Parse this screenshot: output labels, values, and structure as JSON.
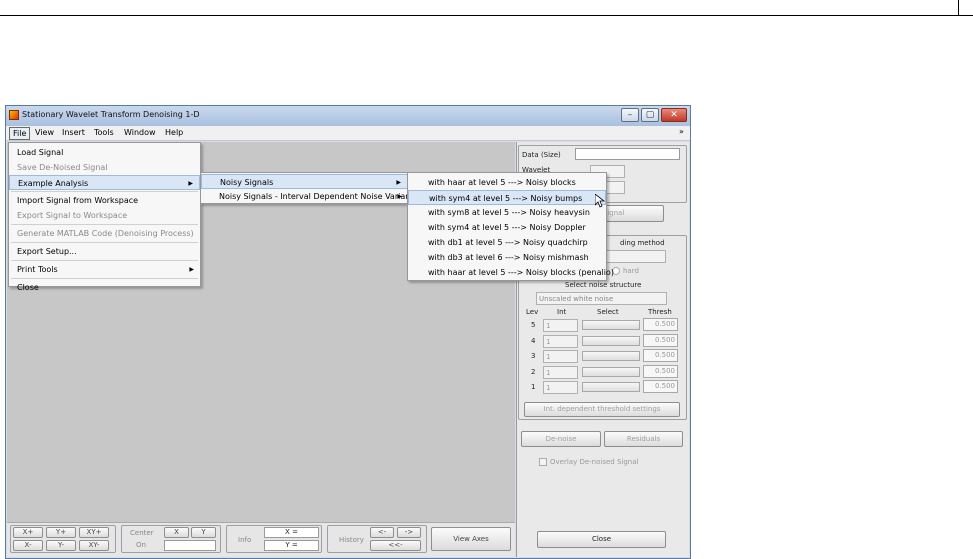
{
  "window": {
    "title": "Stationary Wavelet Transform Denoising 1-D",
    "controls": [
      "–",
      "▢",
      "✕"
    ]
  },
  "menubar": {
    "items": [
      "File",
      "View",
      "Insert",
      "Tools",
      "Window",
      "Help"
    ],
    "overflow": "»"
  },
  "file_menu": [
    {
      "label": "Load Signal",
      "disabled": false
    },
    {
      "label": "Save De-Noised Signal",
      "disabled": true
    },
    {
      "label": "Example Analysis",
      "disabled": false,
      "submenu": true
    },
    {
      "label": "Import Signal from Workspace",
      "disabled": false
    },
    {
      "label": "Export Signal to Workspace",
      "disabled": true
    },
    {
      "label": "Generate MATLAB Code (Denoising Process)",
      "disabled": true
    },
    {
      "label": "Export Setup...",
      "disabled": false
    },
    {
      "label": "Print Tools",
      "disabled": false,
      "submenu": true
    },
    {
      "label": "Close",
      "disabled": false
    }
  ],
  "example_submenu": [
    {
      "label": "Noisy Signals"
    },
    {
      "label": "Noisy Signals - Interval Dependent Noise Variance"
    }
  ],
  "noisy_submenu": [
    "with haar at level 5  --->  Noisy blocks",
    "with sym4 at level 5  --->  Noisy bumps",
    "with sym8 at level 5  --->  Noisy heavysin",
    "with sym4 at level 5  --->  Noisy Doppler",
    "with db1 at level 5  --->  Noisy quadchirp",
    "with db3 at level 6  --->  Noisy mishmash",
    "with haar at level 5  --->  Noisy blocks (penalio)"
  ],
  "right_panel": {
    "data_size_label": "Data  (Size)",
    "wavelet_label": "Wavelet",
    "analyze_button": "> Signal",
    "thresholding_label": "ding method",
    "hard_label": "hard",
    "noise_structure_label": "Select noise structure",
    "noise_structure_value": "Unscaled white noise",
    "table_headers": {
      "lev": "Lev",
      "int": "Int",
      "select": "Select",
      "thresh": "Thresh"
    },
    "levels": [
      {
        "lev": "5",
        "int": "1",
        "thresh": "0.500"
      },
      {
        "lev": "4",
        "int": "1",
        "thresh": "0.500"
      },
      {
        "lev": "3",
        "int": "1",
        "thresh": "0.500"
      },
      {
        "lev": "2",
        "int": "1",
        "thresh": "0.500"
      },
      {
        "lev": "1",
        "int": "1",
        "thresh": "0.500"
      }
    ],
    "int_dependent_button": "Int. dependent threshold settings",
    "denoise_button": "De-noise",
    "residuals_button": "Residuals",
    "overlay_label": "Overlay De-noised Signal",
    "close_button": "Close"
  },
  "bottom_toolbar": {
    "xplus": "X+",
    "yplus": "Y+",
    "xyplus": "XY+",
    "xminus": "X-",
    "yminus": "Y-",
    "xyminus": "XY-",
    "center_label": "Center",
    "on_label": "On",
    "x_btn": "X",
    "y_btn": "Y",
    "info_label": "Info",
    "x_eq": "X =",
    "y_eq": "Y =",
    "history_label": "History",
    "back": "<-",
    "forward": "->",
    "first": "<<-",
    "view_axes": "View Axes"
  }
}
